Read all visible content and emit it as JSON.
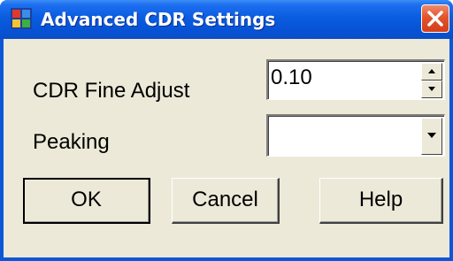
{
  "window": {
    "title": "Advanced CDR Settings",
    "app_icon": "app-window-icon",
    "close_icon": "close-icon"
  },
  "form": {
    "cdr_fine_adjust": {
      "label": "CDR Fine Adjust",
      "value": "0.10"
    },
    "peaking": {
      "label": "Peaking",
      "value": ""
    }
  },
  "buttons": {
    "ok": "OK",
    "cancel": "Cancel",
    "help": "Help"
  },
  "colors": {
    "titlebar": "#0a5ce0",
    "dialog_bg": "#ece9d8",
    "close_button": "#e2532c"
  }
}
